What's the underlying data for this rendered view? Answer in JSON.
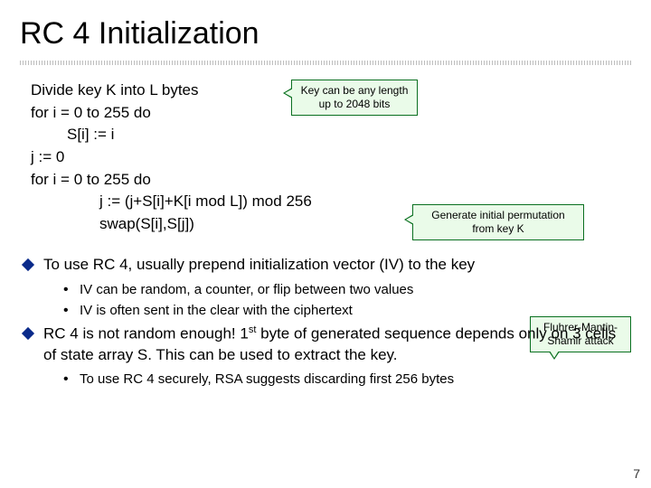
{
  "title": "RC 4 Initialization",
  "algo": {
    "l1": "Divide key K into L bytes",
    "l2": "for i = 0 to 255 do",
    "l3": "S[i] := i",
    "l4": "j := 0",
    "l5": "for i = 0 to 255 do",
    "l6": "j := (j+S[i]+K[i mod L]) mod 256",
    "l7": "swap(S[i],S[j])"
  },
  "callouts": {
    "c1a": "Key can be any length",
    "c1b": "up to 2048 bits",
    "c2a": "Generate initial permutation",
    "c2b": "from key K",
    "c3a": "Fluhrer-Mantin-",
    "c3b": "Shamir attack"
  },
  "bullets": {
    "b1": "To use RC 4, usually prepend initialization vector (IV) to the key",
    "b1a": "IV can be random, a counter, or flip between two values",
    "b1b": "IV is often sent in the clear with the ciphertext",
    "b2_pre": "RC 4 is not random enough!  1",
    "b2_sup": "st",
    "b2_post": " byte of generated sequence depends only on 3 cells of state array S.  This can be used to extract the key.",
    "b2a": "To use RC 4 securely, RSA suggests discarding first 256 bytes"
  },
  "page": "7"
}
